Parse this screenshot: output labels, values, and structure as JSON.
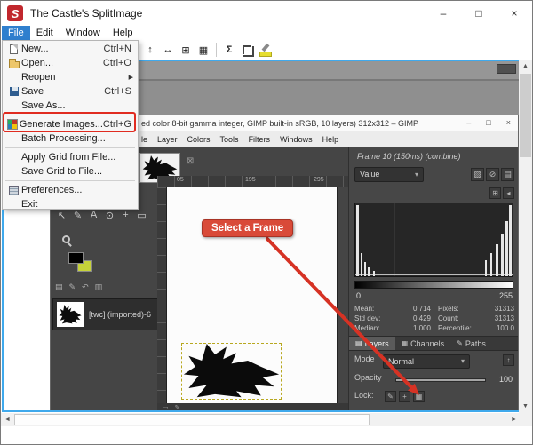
{
  "titlebar": {
    "title": "The Castle's SplitImage",
    "logo_letter": "S",
    "minimize": "–",
    "maximize": "□",
    "close": "×"
  },
  "menubar": {
    "items": [
      "File",
      "Edit",
      "Window",
      "Help"
    ]
  },
  "toolbar": {
    "split_rows_glyph": "↕",
    "split_cols_glyph": "↔",
    "insert_glyph": "⊞",
    "grid_glyph": "▦",
    "sum_glyph": "Σ"
  },
  "file_menu": {
    "items": [
      {
        "label": "New...",
        "shortcut": "Ctrl+N"
      },
      {
        "label": "Open...",
        "shortcut": "Ctrl+O"
      },
      {
        "label": "Reopen",
        "submenu_arrow": "▶"
      },
      {
        "label": "Save",
        "shortcut": "Ctrl+S"
      },
      {
        "label": "Save As..."
      },
      {
        "label": "Generate Images...",
        "shortcut": "Ctrl+G"
      },
      {
        "label": "Batch Processing..."
      },
      {
        "label": "Apply Grid from File..."
      },
      {
        "label": "Save Grid to File..."
      },
      {
        "label": "Preferences..."
      },
      {
        "label": "Exit"
      }
    ]
  },
  "annotations": {
    "select_frame": "Select a Frame"
  },
  "screenshot": {
    "gimp_title": "ed color 8-bit gamma integer, GIMP built-in sRGB, 10 layers) 312x312 – GIMP",
    "gimp_controls": {
      "minimize": "–",
      "maximize": "□",
      "close": "×"
    },
    "gimp_menu": [
      "le",
      "Layer",
      "Colors",
      "Tools",
      "Filters",
      "Windows",
      "Help"
    ],
    "ruler_marks": [
      "05",
      "195",
      "295"
    ],
    "toolbox_tools": [
      "↖",
      "✎",
      "A",
      "⊙",
      "+",
      "▭"
    ],
    "toolbox_mini": [
      "▤",
      "✎",
      "↶",
      "▥"
    ],
    "close_box_glyph": "⊠",
    "layer_item_label": "[twc] (imported)-6",
    "histogram": {
      "frame_header": "Frame 10 (150ms) (combine)",
      "channel": "Value",
      "dropdown_arrow": "▾",
      "icons": [
        "▧",
        "⊘",
        "▤"
      ],
      "mini_icons": [
        "⊞",
        "◂"
      ],
      "range_min": "0",
      "range_max": "255",
      "stats_left": [
        [
          "Mean:",
          "0.714"
        ],
        [
          "Std dev:",
          "0.429"
        ],
        [
          "Median:",
          "1.000"
        ]
      ],
      "stats_right": [
        [
          "Pixels:",
          "31313"
        ],
        [
          "Count:",
          "31313"
        ],
        [
          "Percentile:",
          "100.0"
        ]
      ]
    },
    "layers_panel": {
      "tabs": [
        {
          "icon": "▤",
          "label": "Layers"
        },
        {
          "icon": "▦",
          "label": "Channels"
        },
        {
          "icon": "✎",
          "label": "Paths"
        }
      ],
      "mode_label": "Mode",
      "mode_value": "Normal",
      "mode_arrow": "▾",
      "mode_btn": "↕",
      "opacity_label": "Opacity",
      "opacity_value": "100",
      "lock_label": "Lock:",
      "lock_icons": [
        "✎",
        "+",
        "▦"
      ]
    },
    "status_icons": [
      "▭",
      "✎"
    ]
  },
  "scroll": {
    "up": "▲",
    "down": "▼",
    "left": "◄",
    "right": "►"
  }
}
